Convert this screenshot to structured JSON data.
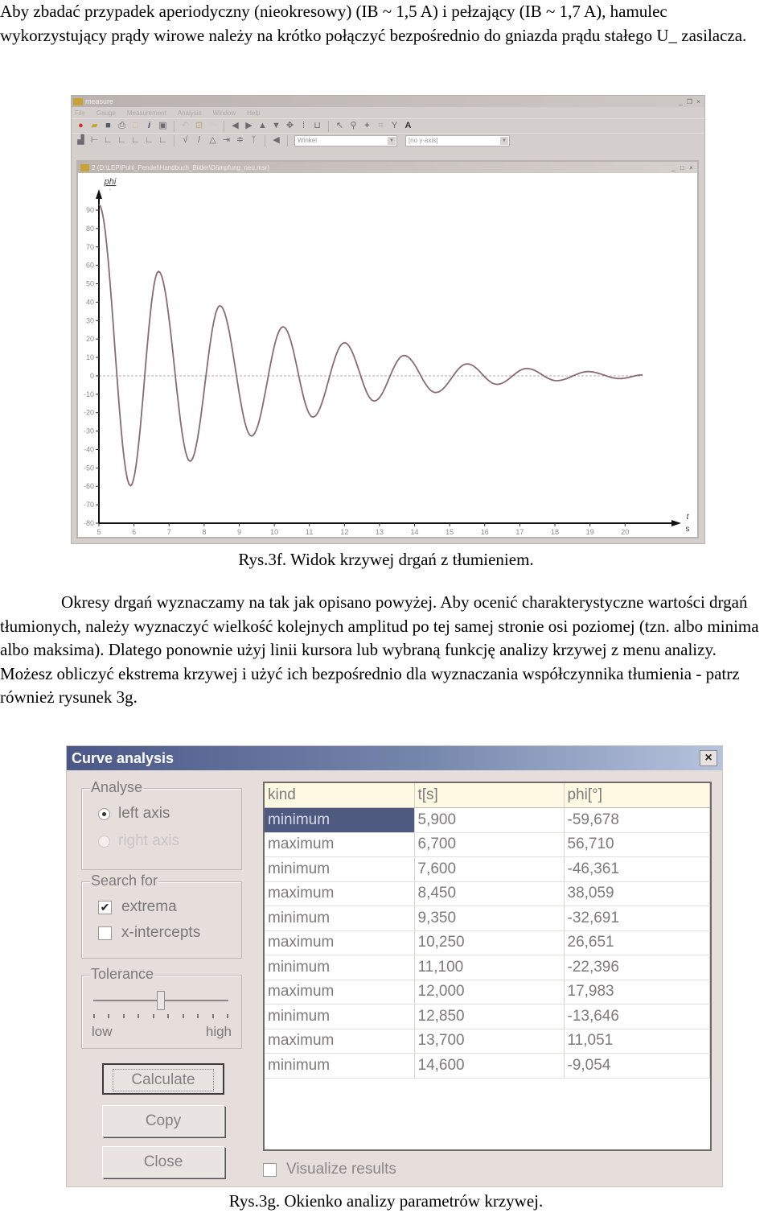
{
  "intro_text": "Aby zbadać przypadek aperiodyczny (nieokresowy) (IB ~ 1,5 A) i pełzający (IB ~ 1,7 A), hamulec wykorzystujący prądy wirowe należy na krótko połączyć bezpośrednio do gniazda prądu stałego U_ zasilacza.",
  "figure1": {
    "caption": "Rys.3f. Widok krzywej drgań z tłumieniem.",
    "app_title": "measure",
    "menu": [
      "File",
      "Gauge",
      "Measurement",
      "Analysis",
      "Window",
      "Help"
    ],
    "combo1_value": "Winkel",
    "combo2_value": "[no y-axis]",
    "doc_title": "2 (D:\\LEP\\Pohl_Pendel\\Handbuch_Bilder\\Dämpfung_neu.msr)",
    "toolbar1_icons": [
      "record-icon",
      "open-icon",
      "save-icon",
      "print-icon",
      "window-icon",
      "info-icon",
      "image-icon",
      "undo-icon",
      "clipboard-icon",
      "redo-icon",
      "left-icon",
      "right-icon",
      "up-icon",
      "down-icon",
      "move-icon",
      "zoom-x-icon",
      "zoom-y-icon",
      "pointer-icon",
      "magnifier-icon",
      "crosshair-icon",
      "grid-icon",
      "marker-icon",
      "text-icon"
    ],
    "toolbar2_icons": [
      "histogram-icon",
      "curve-icon",
      "axis1-icon",
      "axis2-icon",
      "axis3-icon",
      "axis4-icon",
      "axis5-icon",
      "fit-icon",
      "pen-icon",
      "measure-icon",
      "arrow-icon",
      "filter-icon",
      "tool-icon",
      "sound-icon"
    ]
  },
  "chart_data": {
    "type": "line",
    "title": "",
    "ylabel": "phi",
    "yunit": "°",
    "xlabel": "t",
    "xunit": "s",
    "xlim": [
      5,
      20.5
    ],
    "ylim": [
      -80,
      95
    ],
    "xticks": [
      5,
      6,
      7,
      8,
      9,
      10,
      11,
      12,
      13,
      14,
      15,
      16,
      17,
      18,
      19,
      20
    ],
    "yticks": [
      90,
      80,
      70,
      60,
      50,
      40,
      30,
      20,
      10,
      0,
      -10,
      -20,
      -30,
      -40,
      -50,
      -60,
      -70,
      -80
    ],
    "zero_line": "dashed",
    "series": [
      {
        "name": "phi",
        "color": "#8a6a74",
        "extrema": [
          {
            "t": 5.0,
            "phi": 93
          },
          {
            "t": 5.9,
            "phi": -59.678
          },
          {
            "t": 6.7,
            "phi": 56.71
          },
          {
            "t": 7.6,
            "phi": -46.361
          },
          {
            "t": 8.45,
            "phi": 38.059
          },
          {
            "t": 9.35,
            "phi": -32.691
          },
          {
            "t": 10.25,
            "phi": 26.651
          },
          {
            "t": 11.1,
            "phi": -22.396
          },
          {
            "t": 12.0,
            "phi": 17.983
          },
          {
            "t": 12.85,
            "phi": -13.646
          },
          {
            "t": 13.7,
            "phi": 11.051
          },
          {
            "t": 14.6,
            "phi": -9.054
          },
          {
            "t": 15.5,
            "phi": 6.5
          },
          {
            "t": 16.35,
            "phi": -4.6
          },
          {
            "t": 17.2,
            "phi": 4.0
          },
          {
            "t": 18.05,
            "phi": -2.6
          },
          {
            "t": 18.95,
            "phi": 2.3
          },
          {
            "t": 19.85,
            "phi": -1.5
          },
          {
            "t": 20.5,
            "phi": 0.5
          }
        ]
      }
    ]
  },
  "body_text": "Okresy drgań wyznaczamy na tak jak opisano powyżej. Aby ocenić charakterystyczne wartości drgań tłumionych, należy wyznaczyć wielkość kolejnych amplitud po tej samej stronie osi poziomej (tzn. albo minima albo maksima). Dlatego ponownie użyj linii kursora lub wybraną funkcję analizy krzywej z menu analizy. Możesz obliczyć ekstrema krzywej i użyć ich bezpośrednio dla wyznaczania współczynnika tłumienia - patrz również rysunek 3g.",
  "dialog": {
    "title": "Curve analysis",
    "close_label": "×",
    "analyse": {
      "legend": "Analyse",
      "left_axis": "left axis",
      "right_axis": "right axis",
      "selected": "left axis"
    },
    "search_for": {
      "legend": "Search for",
      "extrema": "extrema",
      "extrema_checked": true,
      "x_intercepts": "x-intercepts",
      "x_intercepts_checked": false
    },
    "tolerance": {
      "legend": "Tolerance",
      "low": "low",
      "high": "high",
      "value_fraction": 0.5
    },
    "buttons": {
      "calculate": "Calculate",
      "copy": "Copy",
      "close": "Close"
    },
    "table": {
      "headers": [
        "kind",
        "t[s]",
        "phi[°]"
      ],
      "rows": [
        [
          "minimum",
          "5,900",
          "-59,678"
        ],
        [
          "maximum",
          "6,700",
          "56,710"
        ],
        [
          "minimum",
          "7,600",
          "-46,361"
        ],
        [
          "maximum",
          "8,450",
          "38,059"
        ],
        [
          "minimum",
          "9,350",
          "-32,691"
        ],
        [
          "maximum",
          "10,250",
          "26,651"
        ],
        [
          "minimum",
          "11,100",
          "-22,396"
        ],
        [
          "maximum",
          "12,000",
          "17,983"
        ],
        [
          "minimum",
          "12,850",
          "-13,646"
        ],
        [
          "maximum",
          "13,700",
          "11,051"
        ],
        [
          "minimum",
          "14,600",
          "-9,054"
        ]
      ],
      "selected_row": 0
    },
    "visualize_label": "Visualize results",
    "visualize_checked": false
  },
  "figure2_caption": "Rys.3g. Okienko analizy parametrów krzywej."
}
